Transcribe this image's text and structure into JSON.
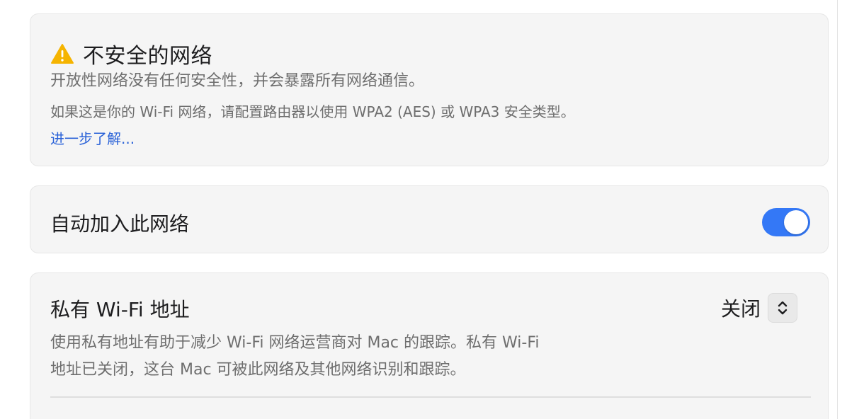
{
  "insecure": {
    "title": "不安全的网络",
    "icon": "warning-icon",
    "description": "开放性网络没有任何安全性，并会暴露所有网络通信。",
    "advice": "如果这是你的 Wi-Fi 网络，请配置路由器以使用 WPA2 (AES) 或 WPA3 安全类型。",
    "learn_more": "进一步了解...",
    "colors": {
      "warning": "#f5b400",
      "link": "#2a62d8"
    }
  },
  "auto_join": {
    "label": "自动加入此网络",
    "enabled": true,
    "colors": {
      "toggle_on": "#3478f6"
    }
  },
  "private_wifi": {
    "title": "私有 Wi-Fi 地址",
    "value": "关闭",
    "description_line1": "使用私有地址有助于减少 Wi-Fi 网络运营商对 Mac 的跟踪。私有 Wi-Fi",
    "description_line2": "地址已关闭，这台 Mac 可被此网络及其他网络识别和跟踪。",
    "icon": "chevron-up-down-icon"
  }
}
